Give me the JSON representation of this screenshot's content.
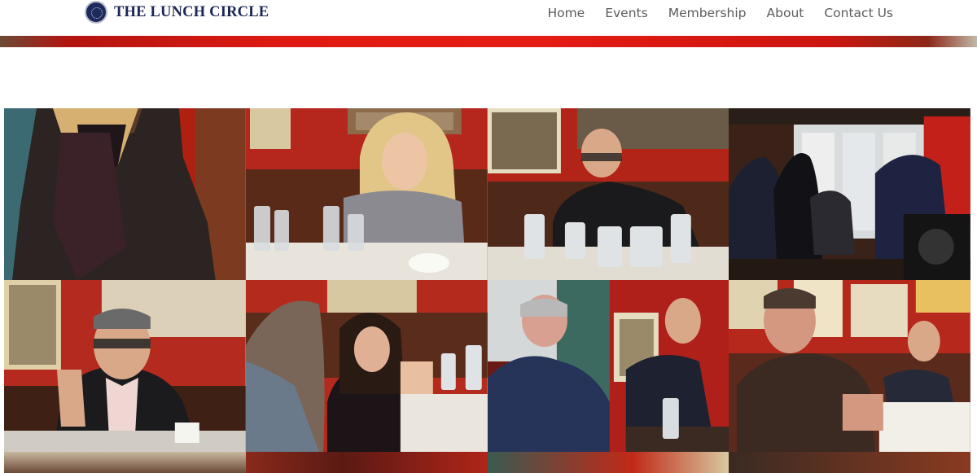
{
  "site": {
    "brand_name": "THE LUNCH CIRCLE"
  },
  "nav": {
    "items": [
      "Home",
      "Events",
      "Membership",
      "About",
      "Contact Us"
    ]
  },
  "colors": {
    "brand_navy": "#1c2654",
    "nav_text": "#5c5c5c",
    "banner_red": "#e01a12"
  },
  "gallery": {
    "photos": [
      {
        "subject": "woman-in-leather-jacket"
      },
      {
        "subject": "woman-smiling-at-table"
      },
      {
        "subject": "man-in-glasses-gesturing"
      },
      {
        "subject": "guests-standing-at-bar"
      },
      {
        "subject": "man-in-glasses-closeup"
      },
      {
        "subject": "woman-with-necklace-at-table"
      },
      {
        "subject": "two-men-talking"
      },
      {
        "subject": "man-in-suit-hands-clasped"
      },
      {
        "subject": "partial-photo"
      },
      {
        "subject": "partial-photo"
      },
      {
        "subject": "partial-photo"
      },
      {
        "subject": "partial-photo"
      }
    ]
  }
}
